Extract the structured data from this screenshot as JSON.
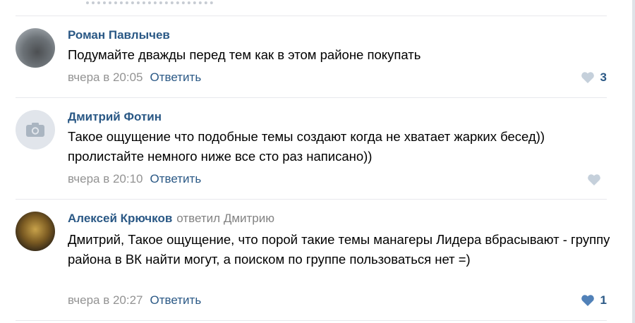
{
  "comments": [
    {
      "author": "Роман Павлычев",
      "text": "Подумайте дважды перед тем как в этом районе покупать",
      "time": "вчера в 20:05",
      "reply": "Ответить",
      "likes": "3",
      "avatar": "photo-avatar"
    },
    {
      "author": "Дмитрий Фотин",
      "text": "Такое ощущение что подобные темы создают когда не хватает жарких бесед)) пролистайте немного ниже все сто раз написано))",
      "time": "вчера в 20:10",
      "reply": "Ответить",
      "likes": "",
      "avatar": "camera-icon"
    },
    {
      "author": "Алексей Крючков",
      "reply_to": "ответил Дмитрию",
      "text": "Дмитрий, Такое ощущение, что порой такие темы манагеры Лидера вбрасывают - группу района в ВК найти могут, а поиском по группе пользоваться нет =)",
      "time": "вчера в 20:27",
      "reply": "Ответить",
      "likes": "1",
      "avatar": "photo-avatar"
    }
  ],
  "colors": {
    "link": "#2a5885",
    "meta": "#939393",
    "heart_inactive": "#c5d0db",
    "heart_active": "#5181b8"
  }
}
